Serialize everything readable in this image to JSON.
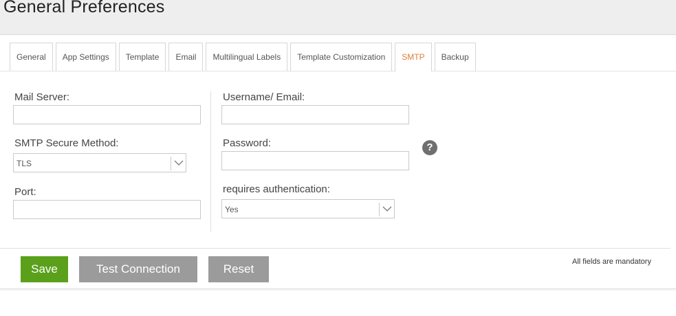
{
  "page": {
    "title": "General Preferences"
  },
  "tabs": [
    {
      "label": "General"
    },
    {
      "label": "App Settings"
    },
    {
      "label": "Template"
    },
    {
      "label": "Email"
    },
    {
      "label": "Multilingual Labels"
    },
    {
      "label": "Template Customization"
    },
    {
      "label": "SMTP",
      "active": true
    },
    {
      "label": "Backup"
    }
  ],
  "form": {
    "mail_server": {
      "label": "Mail Server:",
      "value": ""
    },
    "smtp_secure_method": {
      "label": "SMTP Secure Method:",
      "selected": "TLS"
    },
    "port": {
      "label": "Port:",
      "value": ""
    },
    "username": {
      "label": "Username/ Email:",
      "value": ""
    },
    "password": {
      "label": "Password:",
      "value": ""
    },
    "requires_auth": {
      "label": "requires authentication:",
      "selected": "Yes"
    },
    "help_icon_glyph": "?"
  },
  "actions": {
    "save_label": "Save",
    "test_label": "Test Connection",
    "reset_label": "Reset",
    "mandatory_note": "All fields are mandatory"
  },
  "colors": {
    "accent_tab": "#e07b39",
    "save_button": "#5aa01a",
    "secondary_button": "#9b9b9b"
  },
  "icons": [
    "help-icon",
    "chevron-down-icon"
  ]
}
